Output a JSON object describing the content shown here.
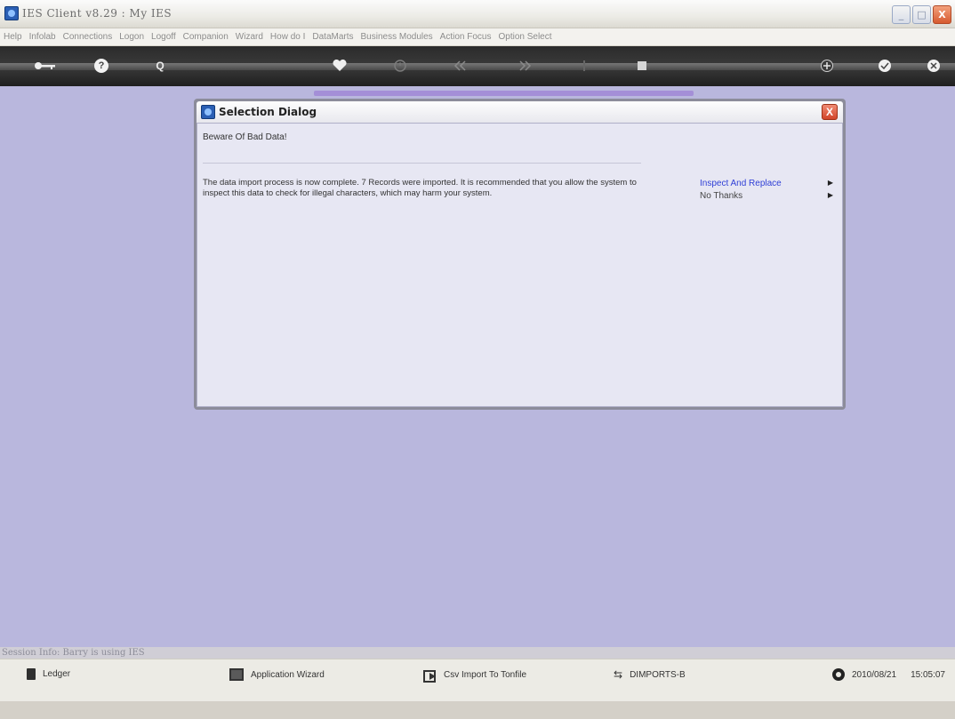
{
  "window": {
    "title": "IES Client v8.29 : My IES",
    "min_label": "_",
    "max_label": "□",
    "close_label": "X"
  },
  "menu": [
    "Help",
    "Infolab",
    "Connections",
    "Logon",
    "Logoff",
    "Companion",
    "Wizard",
    "How do I",
    "DataMarts",
    "Business Modules",
    "Action Focus",
    "Option Select"
  ],
  "toolbar": {
    "icons": [
      "key-icon",
      "help-icon",
      "search-icon",
      "heart-icon",
      "clock-icon",
      "back-icon",
      "forward-icon",
      "info-icon",
      "stop-icon",
      "add-icon",
      "check-icon",
      "close-icon"
    ],
    "help": "?",
    "search": "Q"
  },
  "dialog": {
    "title": "Selection Dialog",
    "close_label": "X",
    "subtitle": "Beware Of Bad Data!",
    "message": "The data import process is now complete. 7 Records were imported. It is recommended that you allow the system to inspect this data to check for illegal characters, which may harm your system.",
    "options": [
      {
        "label": "Inspect And Replace",
        "arrow": "▶"
      },
      {
        "label": "No Thanks",
        "arrow": "▶"
      }
    ]
  },
  "session": {
    "text": "Session Info: Barry is using IES"
  },
  "status": {
    "ledger": "Ledger",
    "app_wizard": "Application Wizard",
    "csv_import": "Csv Import To Tonfile",
    "dimports_glyph": "⇆",
    "dimports": "DIMPORTS-B",
    "date": "2010/08/21",
    "time": "15:05:07"
  }
}
